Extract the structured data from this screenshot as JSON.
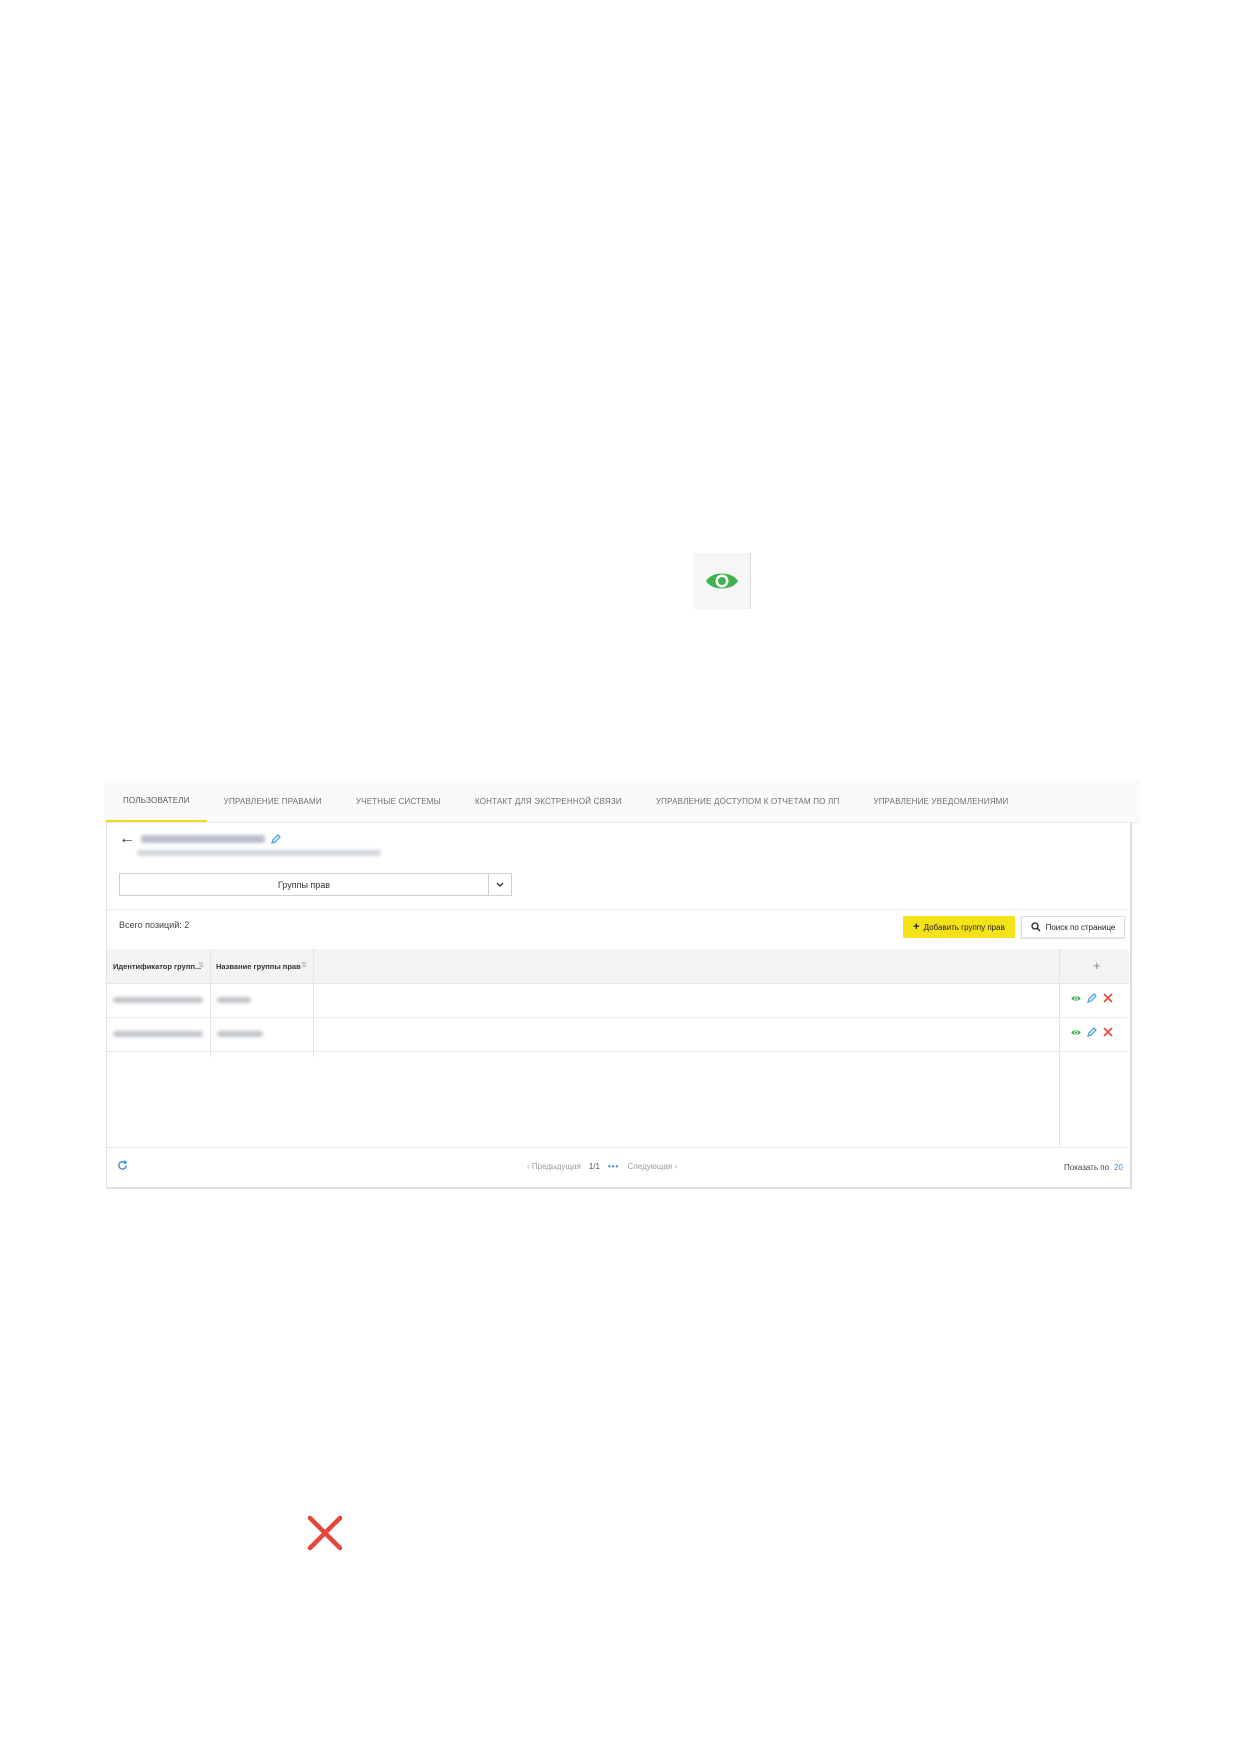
{
  "icons": {
    "eye": "eye-icon",
    "cross": "close-icon",
    "eye_color": "#3fb34f",
    "cross_color": "#e5463a",
    "pencil_color": "#4aa3df",
    "accent_yellow": "#f5e21a"
  },
  "tabs": [
    {
      "label": "Пользователи",
      "active": true
    },
    {
      "label": "Управление правами",
      "active": false
    },
    {
      "label": "Учетные системы",
      "active": false
    },
    {
      "label": "Контакт для экстренной связи",
      "active": false
    },
    {
      "label": "Управление доступом к отчетам по ЛП",
      "active": false
    },
    {
      "label": "Управление уведомлениями",
      "active": false
    }
  ],
  "panel": {
    "select_value": "Группы прав",
    "total_label": "Всего позиций: 2",
    "add_button": "Добавить группу прав",
    "search_button": "Поиск по странице"
  },
  "table": {
    "columns": [
      "Идентификатор групп...",
      "Название группы прав"
    ],
    "row_count": 2
  },
  "pager": {
    "prev": "Предыдущая",
    "current": "1/1",
    "dots": "•••",
    "next": "Следующая",
    "show_by_label": "Показать по",
    "show_by_value": "20"
  }
}
